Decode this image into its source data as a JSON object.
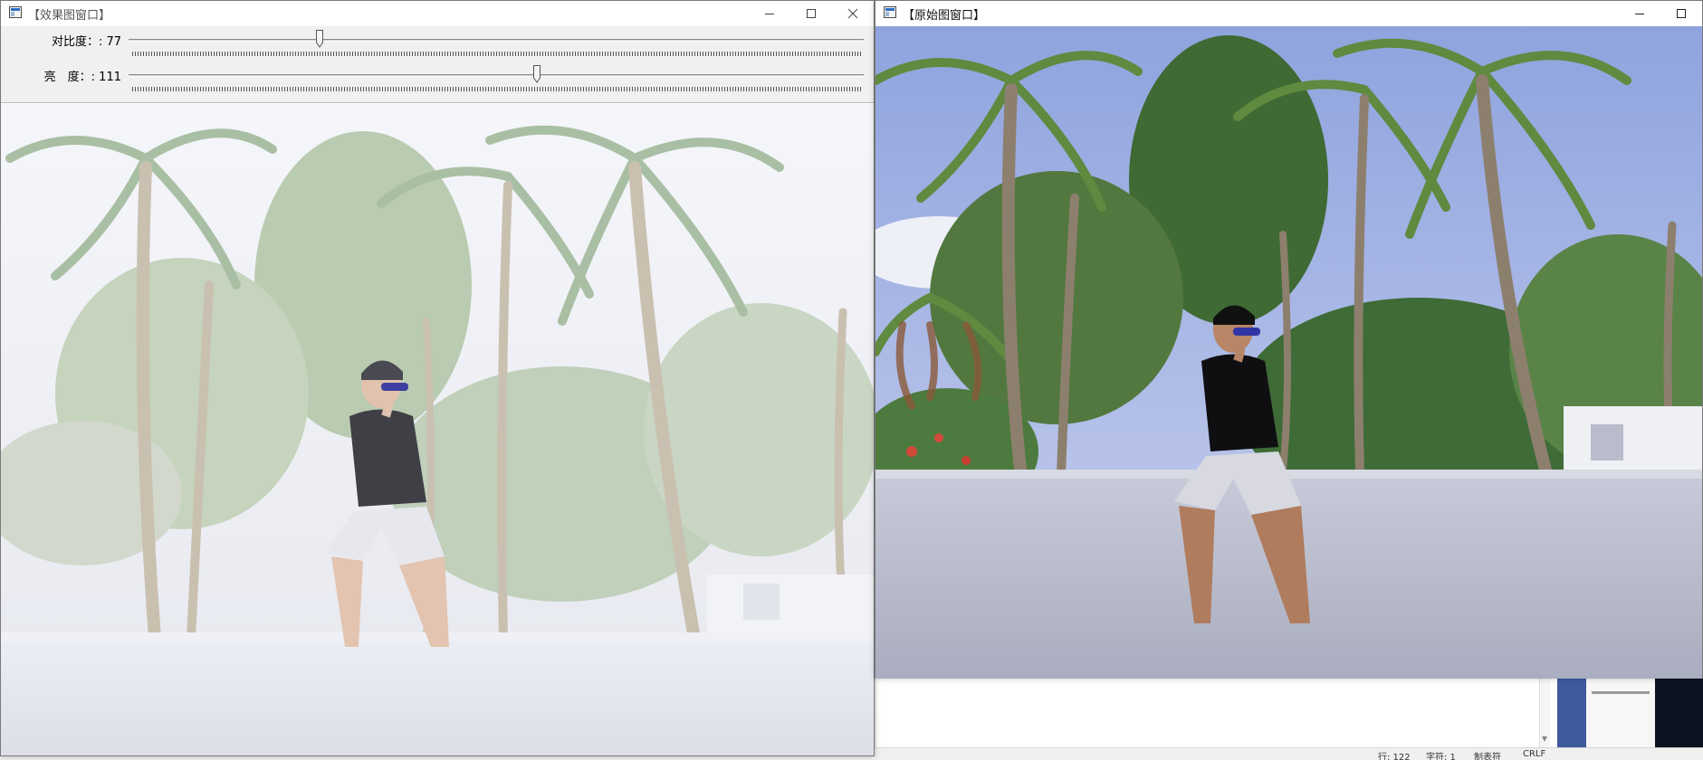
{
  "left_window": {
    "title": "【效果图窗口】",
    "trackbars": [
      {
        "label": "对比度：: 77",
        "value": 77,
        "max": 300
      },
      {
        "label": "亮　度：: 111",
        "value": 111,
        "max": 200
      }
    ],
    "image_name": "effect-photo"
  },
  "right_window": {
    "title": "【原始图窗口】",
    "image_name": "original-photo"
  },
  "window_controls": [
    "minimize-icon",
    "maximize-icon",
    "close-icon"
  ],
  "background_status": {
    "line": "行: 122",
    "col": "字符: 1",
    "tab": "制表符",
    "eol": "CRLF"
  },
  "colors": {
    "sky_left": "#eef0f6",
    "sky_right": "#a8b6e6",
    "wall": "#d9dbe6",
    "panel": "#f0f0f0"
  }
}
